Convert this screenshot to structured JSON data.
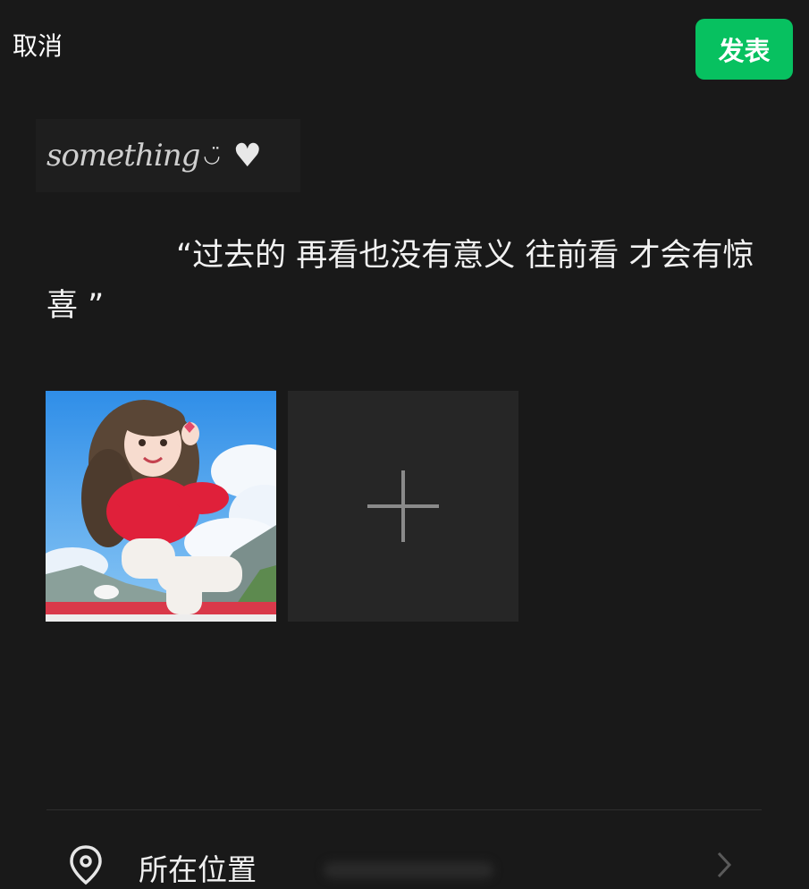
{
  "header": {
    "cancel_label": "取消",
    "publish_label": "发表"
  },
  "decoration": {
    "text": "something",
    "smile": "◡̈",
    "heart": "♥"
  },
  "post": {
    "text": "“过去的 再看也没有意义 往前看 才会有惊喜 ”"
  },
  "media": {
    "photo_count": 1,
    "add_icon": "plus-icon"
  },
  "location": {
    "label": "所在位置",
    "icon": "location-pin-icon",
    "chevron": "chevron-right-icon"
  },
  "colors": {
    "background": "#191919",
    "accent": "#07c160"
  }
}
